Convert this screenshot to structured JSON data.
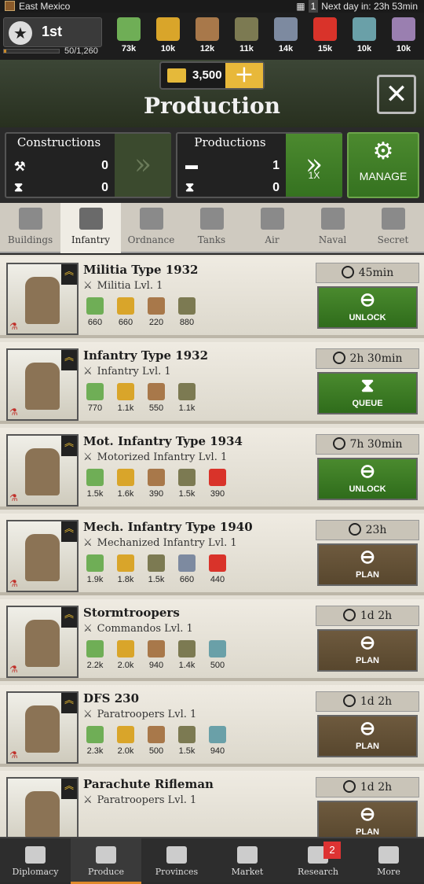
{
  "status": {
    "region": "East Mexico",
    "day_num": "1",
    "next_day": "Next day in: 23h 53min"
  },
  "rank": {
    "label": "1st",
    "xp": "50/1,260",
    "xp_fraction": 0.04
  },
  "resources": [
    {
      "name": "money",
      "value": "73k",
      "color": "#6fae56"
    },
    {
      "name": "supplies",
      "value": "10k",
      "color": "#d9a52a"
    },
    {
      "name": "components",
      "value": "12k",
      "color": "#a8784a"
    },
    {
      "name": "manpower",
      "value": "11k",
      "color": "#7c7a52"
    },
    {
      "name": "steel",
      "value": "14k",
      "color": "#7d8aa0"
    },
    {
      "name": "fuel",
      "value": "15k",
      "color": "#d9332a"
    },
    {
      "name": "rare-materials",
      "value": "10k",
      "color": "#6aa0a8"
    },
    {
      "name": "goods",
      "value": "10k",
      "color": "#9a7fb0"
    }
  ],
  "gold": {
    "value": "3,500",
    "plus": "+"
  },
  "header": {
    "title": "Production",
    "close": "✕"
  },
  "constructions": {
    "label": "Constructions",
    "hammer": "0",
    "hourglass": "0"
  },
  "productions": {
    "label": "Productions",
    "tank": "1",
    "hourglass": "0",
    "speed": "1X"
  },
  "manage": {
    "label": "MANAGE"
  },
  "tabs": [
    {
      "label": "Buildings",
      "selected": false
    },
    {
      "label": "Infantry",
      "selected": true
    },
    {
      "label": "Ordnance",
      "selected": false
    },
    {
      "label": "Tanks",
      "selected": false
    },
    {
      "label": "Air",
      "selected": false
    },
    {
      "label": "Naval",
      "selected": false
    },
    {
      "label": "Secret",
      "selected": false
    }
  ],
  "units": [
    {
      "name": "Militia Type 1932",
      "class": "Militia Lvl. 1",
      "time": "45min",
      "action": "UNLOCK",
      "costs": [
        "660",
        "660",
        "220",
        "880"
      ]
    },
    {
      "name": "Infantry Type 1932",
      "class": "Infantry Lvl. 1",
      "time": "2h 30min",
      "action": "QUEUE",
      "costs": [
        "770",
        "1.1k",
        "550",
        "1.1k"
      ]
    },
    {
      "name": "Mot. Infantry Type 1934",
      "class": "Motorized Infantry Lvl. 1",
      "time": "7h 30min",
      "action": "UNLOCK",
      "costs": [
        "1.5k",
        "1.6k",
        "390",
        "1.5k",
        "390"
      ]
    },
    {
      "name": "Mech. Infantry Type 1940",
      "class": "Mechanized Infantry Lvl. 1",
      "time": "23h",
      "action": "PLAN",
      "costs": [
        "1.9k",
        "1.8k",
        "1.5k",
        "660",
        "440"
      ]
    },
    {
      "name": "Stormtroopers",
      "class": "Commandos Lvl. 1",
      "time": "1d 2h",
      "action": "PLAN",
      "costs": [
        "2.2k",
        "2.0k",
        "940",
        "1.4k",
        "500"
      ]
    },
    {
      "name": "DFS 230",
      "class": "Paratroopers Lvl. 1",
      "time": "1d 2h",
      "action": "PLAN",
      "costs": [
        "2.3k",
        "2.0k",
        "500",
        "1.5k",
        "940"
      ]
    },
    {
      "name": "Parachute Rifleman",
      "class": "Paratroopers Lvl. 1",
      "time": "1d 2h",
      "action": "PLAN",
      "costs": []
    }
  ],
  "nav": [
    {
      "label": "Diplomacy"
    },
    {
      "label": "Produce"
    },
    {
      "label": "Provinces"
    },
    {
      "label": "Market"
    },
    {
      "label": "Research",
      "badge": "2"
    },
    {
      "label": "More"
    }
  ]
}
